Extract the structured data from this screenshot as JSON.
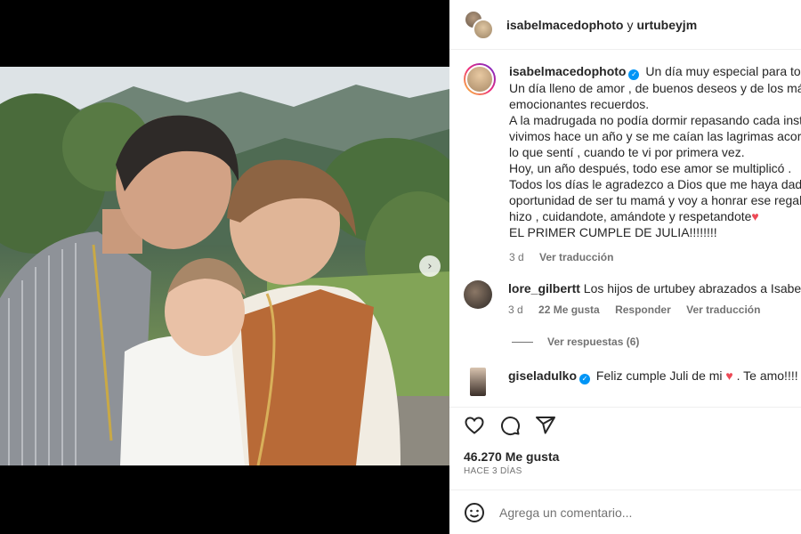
{
  "post": {
    "author": "isabelmacedophoto",
    "connector": "y",
    "coauthor": "urtubeyjm"
  },
  "caption": {
    "username": "isabelmacedophoto",
    "lines": [
      "Un día muy especial para toda",
      "Un día lleno de amor , de buenos deseos y de los más",
      "emocionantes recuerdos.",
      "A la madrugada no podía dormir repasando cada insta",
      "vivimos hace un año y se me caían las lagrimas acordá",
      "lo que sentí , cuando te vi por primera vez.",
      "Hoy, un año después, todo ese amor se multiplicó .",
      "Todos los días le agradezco a Dios que me haya dado",
      "oportunidad de ser tu mamá y voy a honrar ese regalo",
      "hizo , cuidandote, amándote y respetandote",
      "EL PRIMER CUMPLE DE JULIA!!!!!!!!"
    ],
    "age": "3 d",
    "translate": "Ver traducción"
  },
  "comments": [
    {
      "username": "lore_gilbertt",
      "text": "Los hijos de urtubey abrazados a Isabel",
      "age": "3 d",
      "likes": "22 Me gusta",
      "reply": "Responder",
      "translate": "Ver traducción",
      "view_replies": "Ver respuestas (6)"
    },
    {
      "username": "giseladulko",
      "text_before": "Feliz cumple Juli de mi",
      "text_after": ". Te amo!!!!"
    }
  ],
  "likes": "46.270 Me gusta",
  "timestamp": "HACE 3 DÍAS",
  "add_comment": {
    "placeholder": "Agrega un comentario..."
  },
  "colors": {
    "verified": "#0095f6",
    "heart": "#ed4956",
    "secondary_text": "#737373"
  }
}
